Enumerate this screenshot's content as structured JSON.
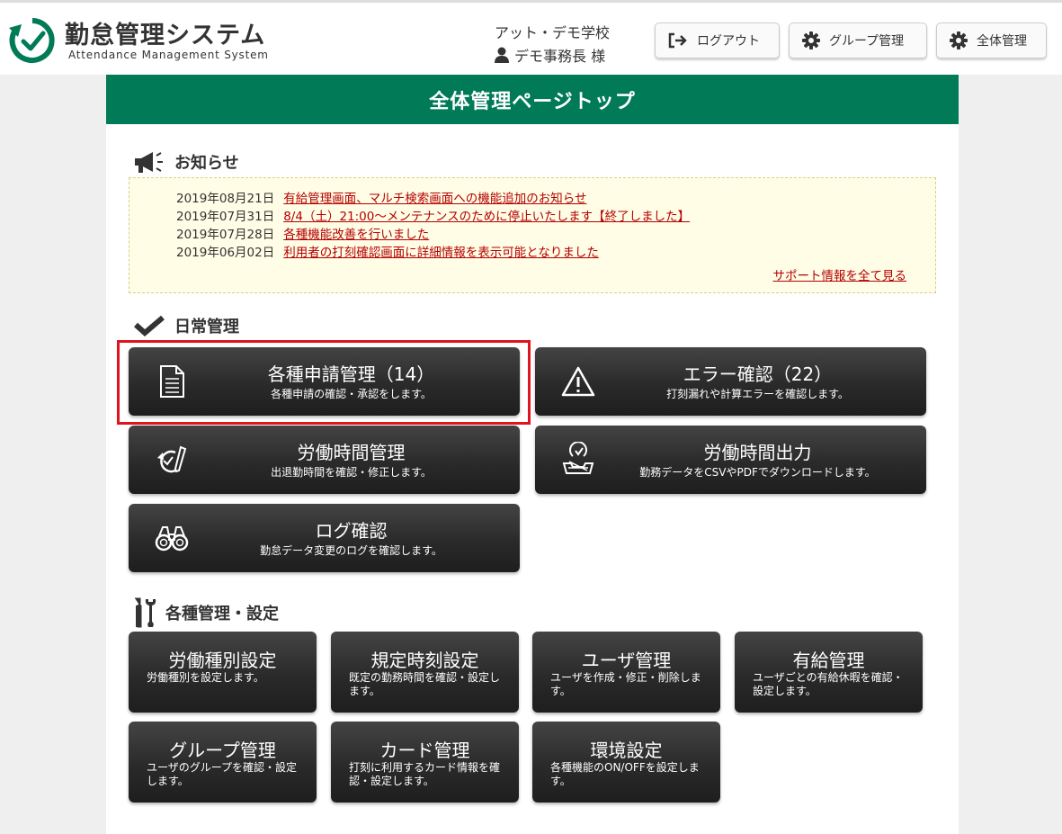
{
  "header": {
    "app_title": "勤怠管理システム",
    "app_subtitle": "Attendance Management System",
    "school": "アット・デモ学校",
    "user": "デモ事務長 様",
    "logout_label": "ログアウト",
    "group_label": "グループ管理",
    "admin_label": "全体管理"
  },
  "page": {
    "title": "全体管理ページトップ"
  },
  "notices": {
    "heading": "お知らせ",
    "items": [
      {
        "date": "2019年08月21日",
        "text": "有給管理画面、マルチ検索画面への機能追加のお知らせ"
      },
      {
        "date": "2019年07月31日",
        "text": "8/4（土）21:00～メンテナンスのために停止いたします【終了しました】"
      },
      {
        "date": "2019年07月28日",
        "text": "各種機能改善を行いました"
      },
      {
        "date": "2019年06月02日",
        "text": "利用者の打刻確認画面に詳細情報を表示可能となりました"
      }
    ],
    "more": "サポート情報を全て見る"
  },
  "daily": {
    "heading": "日常管理",
    "buttons": [
      {
        "title": "各種申請管理（14）",
        "desc": "各種申請の確認・承認をします。"
      },
      {
        "title": "エラー確認（22）",
        "desc": "打刻漏れや計算エラーを確認します。"
      },
      {
        "title": "労働時間管理",
        "desc": "出退勤時間を確認・修正します。"
      },
      {
        "title": "労働時間出力",
        "desc": "勤務データをCSVやPDFでダウンロードします。"
      },
      {
        "title": "ログ確認",
        "desc": "勤怠データ変更のログを確認します。"
      }
    ]
  },
  "settings": {
    "heading": "各種管理・設定",
    "buttons": [
      {
        "title": "労働種別設定",
        "desc": "労働種別を設定します。"
      },
      {
        "title": "規定時刻設定",
        "desc": "既定の勤務時間を確認・設定します。"
      },
      {
        "title": "ユーザ管理",
        "desc": "ユーザを作成・修正・削除します。"
      },
      {
        "title": "有給管理",
        "desc": "ユーザごとの有給休暇を確認・設定します。"
      },
      {
        "title": "グループ管理",
        "desc": "ユーザのグループを確認・設定します。"
      },
      {
        "title": "カード管理",
        "desc": "打刻に利用するカード情報を確認・設定します。"
      },
      {
        "title": "環境設定",
        "desc": "各種機能のON/OFFを設定します。"
      }
    ]
  },
  "colors": {
    "brand_green": "#017a57",
    "link_red": "#b40000",
    "highlight_red": "#e0141e"
  }
}
